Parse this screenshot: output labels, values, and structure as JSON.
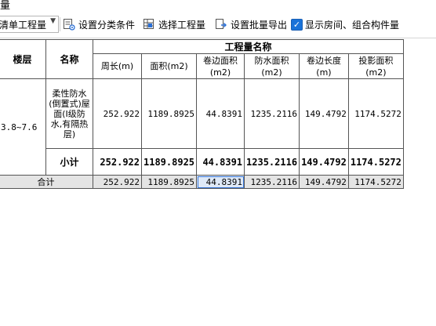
{
  "window": {
    "title_fragment": "量"
  },
  "toolbar": {
    "combo_value": "清单工程量",
    "btn_classify": "设置分类条件",
    "btn_select": "选择工程量",
    "btn_export": "设置批量导出",
    "checkbox_label": "显示房间、组合构件量",
    "checkbox_checked": true
  },
  "table": {
    "header_group": "工程量名称",
    "col_floor": "楼层",
    "col_name": "名称",
    "columns": [
      "周长(m)",
      "面积(m2)",
      "卷边面积(m2)",
      "防水面积(m2)",
      "卷边长度(m)",
      "投影面积(m2)"
    ],
    "row": {
      "floor": "3.8~7.6",
      "name": "柔性防水(倒置式)屋面(I级防水,有隔热层)",
      "values": [
        "252.922",
        "1189.8925",
        "44.8391",
        "1235.2116",
        "149.4792",
        "1174.5272"
      ]
    },
    "subtotal": {
      "label": "小计",
      "values": [
        "252.922",
        "1189.8925",
        "44.8391",
        "1235.2116",
        "149.4792",
        "1174.5272"
      ]
    },
    "total": {
      "label": "合计",
      "values": [
        "252.922",
        "1189.8925",
        "44.8391",
        "1235.2116",
        "149.4792",
        "1174.5272"
      ]
    }
  }
}
